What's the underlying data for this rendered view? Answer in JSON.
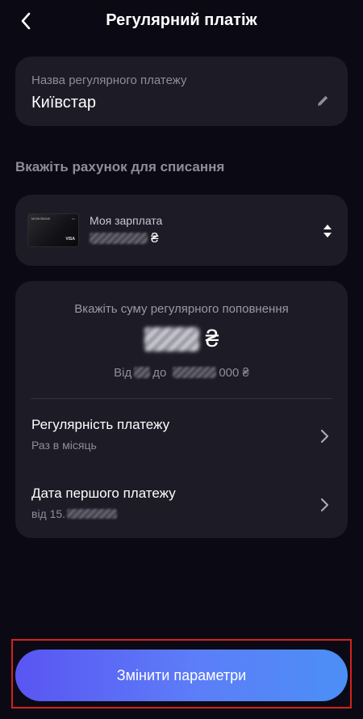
{
  "header": {
    "title": "Регулярний платіж"
  },
  "name_card": {
    "label": "Назва регулярного платежу",
    "value": "Київстар"
  },
  "section_title": "Вкажіть рахунок для списання",
  "account": {
    "name": "Моя зарплата",
    "currency": "₴",
    "card_brand": "VISA"
  },
  "amount": {
    "label": "Вкажіть суму регулярного поповнення",
    "currency": "₴",
    "range_from": "Від",
    "range_to": "до",
    "range_suffix": "000 ₴"
  },
  "frequency": {
    "title": "Регулярність платежу",
    "value": "Раз в місяць"
  },
  "first_payment": {
    "title": "Дата першого платежу",
    "value_prefix": "від 15."
  },
  "primary_button": {
    "label": "Змінити параметри"
  },
  "colors": {
    "background": "#0b0a14",
    "card": "#1c1b26",
    "accent_start": "#5a55f2",
    "accent_end": "#4b8ff6",
    "highlight": "#d4221e"
  },
  "icons": {
    "back": "chevron-left-icon",
    "edit": "pencil-icon",
    "sort": "up-down-arrows-icon",
    "row": "chevron-right-icon"
  }
}
